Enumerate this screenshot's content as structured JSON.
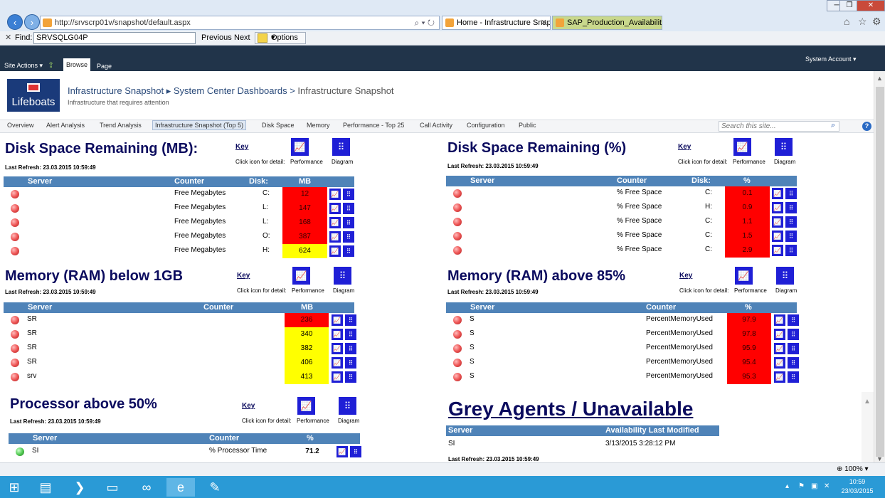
{
  "browser": {
    "address": "http://srvscrp01v/snapshot/default.aspx",
    "tab_active": "Home - Infrastructure Snap...",
    "tab_other": "SAP_Production_Availability",
    "find_label": "Find:",
    "find_value": "SRVSQLG04P",
    "previous": "Previous",
    "next": "Next",
    "options": "Options",
    "zoom": "100%"
  },
  "ribbon": {
    "site_actions": "Site Actions",
    "browse": "Browse",
    "page": "Page",
    "account": "System Account"
  },
  "header": {
    "logo_text": "Lifeboats",
    "crumb1": "Infrastructure Snapshot",
    "crumb2": "System Center Dashboards",
    "crumb3": "Infrastructure Snapshot",
    "subtitle": "Infrastructure that requires attention",
    "search_placeholder": "Search this site..."
  },
  "nav": [
    "Overview",
    "Alert Analysis",
    "Trend Analysis",
    "Infrastructure Snapshot (Top 5)",
    "Disk Space",
    "Memory",
    "Performance - Top 25",
    "Call Activity",
    "Configuration",
    "Public"
  ],
  "common": {
    "key": "Key",
    "click": "Click icon for detail:",
    "performance": "Performance",
    "diagram": "Diagram",
    "refresh": "Last Refresh: 23.03.2015 10:59:49"
  },
  "disk_mb": {
    "title": "Disk Space Remaining (MB):",
    "headers": [
      "Server",
      "Counter",
      "Disk:",
      "MB"
    ],
    "rows": [
      {
        "server": "",
        "counter": "Free Megabytes",
        "disk": "C:",
        "value": "12",
        "color": "red"
      },
      {
        "server": "",
        "counter": "Free Megabytes",
        "disk": "L:",
        "value": "147",
        "color": "red"
      },
      {
        "server": "",
        "counter": "Free Megabytes",
        "disk": "L:",
        "value": "168",
        "color": "red"
      },
      {
        "server": "",
        "counter": "Free Megabytes",
        "disk": "O:",
        "value": "387",
        "color": "red"
      },
      {
        "server": "",
        "counter": "Free Megabytes",
        "disk": "H:",
        "value": "624",
        "color": "yellow"
      }
    ]
  },
  "disk_pct": {
    "title": "Disk Space Remaining (%)",
    "headers": [
      "Server",
      "Counter",
      "Disk:",
      "%"
    ],
    "rows": [
      {
        "server": "",
        "counter": "% Free Space",
        "disk": "C:",
        "value": "0.1",
        "color": "red"
      },
      {
        "server": "",
        "counter": "% Free Space",
        "disk": "H:",
        "value": "0.9",
        "color": "red"
      },
      {
        "server": "",
        "counter": "% Free Space",
        "disk": "C:",
        "value": "1.1",
        "color": "red"
      },
      {
        "server": "",
        "counter": "% Free Space",
        "disk": "C:",
        "value": "1.5",
        "color": "red"
      },
      {
        "server": "",
        "counter": "% Free Space",
        "disk": "C:",
        "value": "2.9",
        "color": "red"
      }
    ]
  },
  "mem_gb": {
    "title": "Memory (RAM) below 1GB",
    "headers": [
      "Server",
      "Counter",
      "MB"
    ],
    "rows": [
      {
        "server": "SR",
        "value": "236",
        "color": "red"
      },
      {
        "server": "SR",
        "value": "340",
        "color": "yellow"
      },
      {
        "server": "SR",
        "value": "382",
        "color": "yellow"
      },
      {
        "server": "SR",
        "value": "406",
        "color": "yellow"
      },
      {
        "server": "srv",
        "value": "413",
        "color": "yellow"
      }
    ]
  },
  "mem_pct": {
    "title": "Memory (RAM) above 85%",
    "headers": [
      "Server",
      "Counter",
      "%"
    ],
    "rows": [
      {
        "server": "S",
        "counter": "PercentMemoryUsed",
        "value": "97.9",
        "color": "red"
      },
      {
        "server": "S",
        "counter": "PercentMemoryUsed",
        "value": "97.8",
        "color": "red"
      },
      {
        "server": "S",
        "counter": "PercentMemoryUsed",
        "value": "95.9",
        "color": "red"
      },
      {
        "server": "S",
        "counter": "PercentMemoryUsed",
        "value": "95.4",
        "color": "red"
      },
      {
        "server": "S",
        "counter": "PercentMemoryUsed",
        "value": "95.3",
        "color": "red"
      }
    ]
  },
  "cpu": {
    "title": "Processor above 50%",
    "headers": [
      "Server",
      "Counter",
      "%"
    ],
    "rows": [
      {
        "server": "SI",
        "counter": "% Processor Time",
        "value": "71.2"
      }
    ]
  },
  "grey": {
    "title": "Grey Agents / Unavailable",
    "headers": [
      "Server",
      "Availability Last Modified"
    ],
    "rows": [
      {
        "server": "SI",
        "modified": "3/13/2015 3:28:12 PM"
      }
    ]
  },
  "taskbar": {
    "time": "10:59",
    "date": "23/03/2015"
  },
  "colors": {
    "red": "#ff0000",
    "yellow": "#ffff00",
    "header": "#4f83b8",
    "title": "#0b0b5e",
    "icon": "#1f1fd6"
  }
}
